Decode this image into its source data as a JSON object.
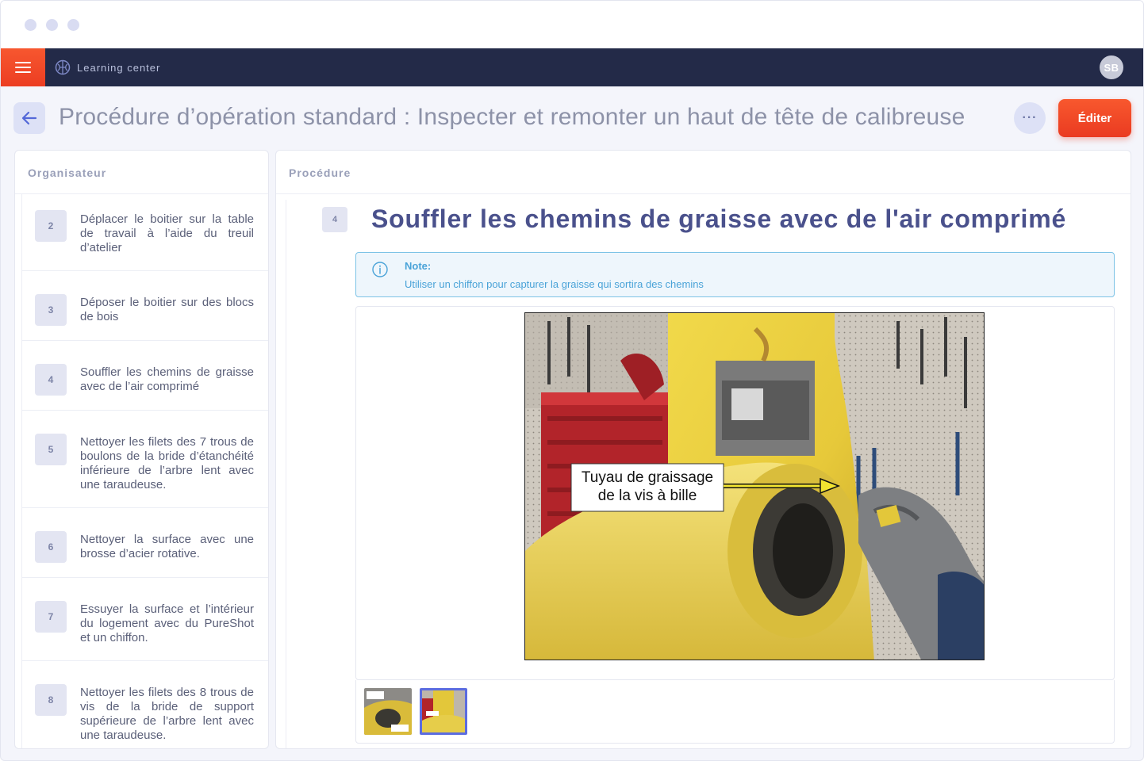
{
  "window": {
    "dots": [
      "window-dot",
      "window-dot",
      "window-dot"
    ]
  },
  "nav": {
    "brand": "Learning center",
    "avatar_initials": "SB"
  },
  "header": {
    "title": "Procédure d’opération standard : Inspecter et remonter un haut de tête de calibreuse",
    "more_label": "···",
    "edit_label": "Éditer"
  },
  "organizer": {
    "heading": "Organisateur",
    "steps": [
      {
        "num": "2",
        "text": "Déplacer le boitier sur la table de travail à l’aide du treuil d’atelier"
      },
      {
        "num": "3",
        "text": "Déposer le boitier sur des blocs de bois"
      },
      {
        "num": "4",
        "text": "Souffler les chemins de graisse avec de l’air comprimé"
      },
      {
        "num": "5",
        "text": "Nettoyer les filets des 7 trous de boulons de la bride d’étanchéité inférieure de l’arbre lent avec une taraudeuse."
      },
      {
        "num": "6",
        "text": "Nettoyer la surface avec une brosse d’acier rotative."
      },
      {
        "num": "7",
        "text": "Essuyer la surface et l’intérieur du logement avec du PureShot et un chiffon."
      },
      {
        "num": "8",
        "text": "Nettoyer les filets des 8 trous de vis de la bride de support supérieure de l’arbre lent avec une taraudeuse."
      }
    ]
  },
  "procedure": {
    "heading": "Procédure",
    "step_num": "4",
    "step_title": "Souffler les chemins de graisse avec de l'air comprimé",
    "note_title": "Note:",
    "note_text": "Utiliser un chiffon pour capturer la graisse qui sortira des chemins",
    "image_caption_line1": "Tuyau de graissage",
    "image_caption_line2": "de la vis à bille",
    "accent_color": "#4a518c",
    "note_color": "#4aa3d8"
  }
}
